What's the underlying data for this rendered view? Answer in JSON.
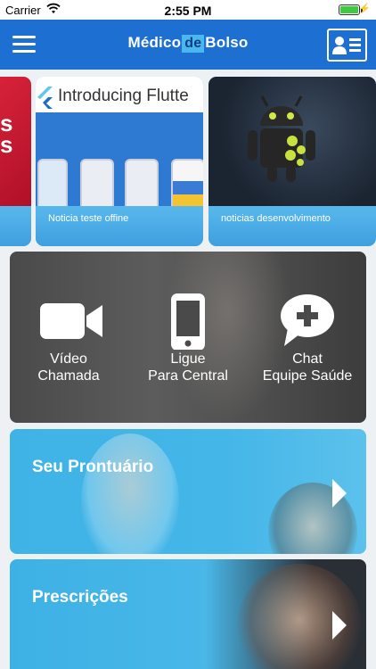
{
  "status_bar": {
    "carrier": "Carrier",
    "time": "2:55 PM"
  },
  "nav": {
    "logo_part1": "Médico",
    "logo_part2": "de",
    "logo_part3": "Bolso",
    "icons": [
      "menu-icon",
      "id-card-icon"
    ]
  },
  "news": [
    {
      "caption": "Noticia teste offine",
      "image_text": "Introducing Flutte"
    },
    {
      "caption": "noticias desenvolvimento"
    }
  ],
  "services": {
    "video": {
      "line1": "Vídeo",
      "line2": "Chamada",
      "icon": "video-camera-icon"
    },
    "call": {
      "line1": "Ligue",
      "line2": "Para Central",
      "icon": "phone-icon"
    },
    "chat": {
      "line1": "Chat",
      "line2": "Equipe Saúde",
      "icon": "chat-plus-icon"
    }
  },
  "banners": {
    "prontuario": "Seu Prontuário",
    "prescricoes": "Prescrições"
  },
  "colors": {
    "primary": "#1d6fd1",
    "light_blue": "#44b6e8",
    "dark_panel": "#4e4e4e"
  }
}
